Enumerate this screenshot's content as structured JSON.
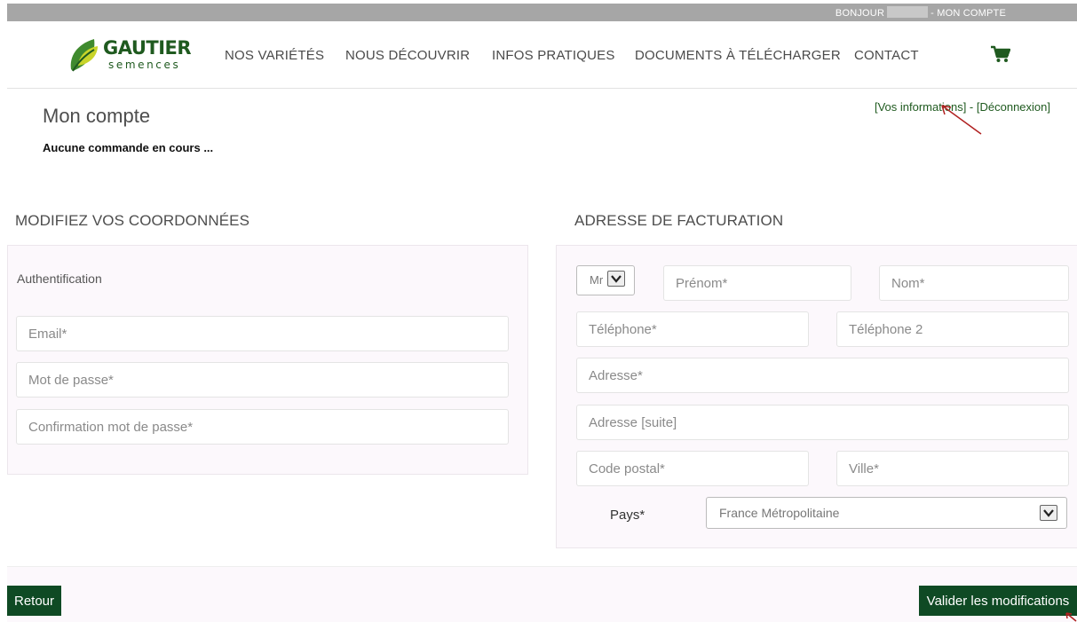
{
  "topbar": {
    "greeting": "BONJOUR",
    "account": "- MON COMPTE"
  },
  "brand": {
    "name": "GAUTIER",
    "sub": "semences",
    "color": "#1f5a1f"
  },
  "nav": {
    "items": [
      "NOS VARIÉTÉS",
      "NOUS DÉCOUVRIR",
      "INFOS PRATIQUES",
      "DOCUMENTS À TÉLÉCHARGER",
      "CONTACT"
    ],
    "cart_icon": "shopping-cart-icon"
  },
  "account": {
    "title": "Mon compte",
    "status": "Aucune commande en cours ...",
    "link_info": "[Vos informations]",
    "separator": " - ",
    "link_logout": "[Déconnexion]"
  },
  "left": {
    "heading": "MODIFIEZ VOS COORDONNÉES",
    "panel_label": "Authentification",
    "email_placeholder": "Email*",
    "password_placeholder": "Mot de passe*",
    "confirm_placeholder": "Confirmation mot de passe*"
  },
  "right": {
    "heading": "ADRESSE DE FACTURATION",
    "civility_value": "Mr",
    "firstname_placeholder": "Prénom*",
    "lastname_placeholder": "Nom*",
    "phone_placeholder": "Téléphone*",
    "phone2_placeholder": "Téléphone 2",
    "address_placeholder": "Adresse*",
    "address2_placeholder": "Adresse [suite]",
    "zip_placeholder": "Code postal*",
    "city_placeholder": "Ville*",
    "country_label": "Pays*",
    "country_value": "France Métropolitaine"
  },
  "buttons": {
    "back": "Retour",
    "save": "Valider les modifications"
  },
  "colors": {
    "accent": "#0f4a24",
    "panel_bg": "#fcf8fc",
    "topbar": "#a6a6a6",
    "annotation": "#b02020"
  }
}
